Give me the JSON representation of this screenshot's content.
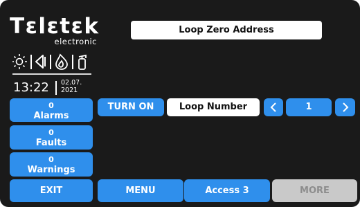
{
  "branding": {
    "logo_main": "Tεlεtεk",
    "logo_sub": "electronic"
  },
  "status_icons": [
    "sun-icon",
    "speaker-icon",
    "flame-icon",
    "extinguisher-icon"
  ],
  "clock": {
    "time": "13:22",
    "date_line1": "02.07.",
    "date_line2": "2021"
  },
  "header": {
    "title": "Loop Zero Address"
  },
  "indicators": {
    "alarms": {
      "count": "0",
      "label": "Alarms"
    },
    "faults": {
      "count": "0",
      "label": "Faults"
    },
    "warnings": {
      "count": "0",
      "label": "Warnings"
    }
  },
  "controls": {
    "turn_on": "TURN ON",
    "loop_number_label": "Loop Number",
    "loop_value": "1",
    "prev_icon": "chevron-left-icon",
    "next_icon": "chevron-right-icon"
  },
  "footer": {
    "exit": "EXIT",
    "menu": "MENU",
    "access": "Access 3",
    "more": "MORE"
  },
  "colors": {
    "accent": "#2f8fec",
    "background": "#1a1a1a",
    "disabled": "#c9c9c9"
  }
}
